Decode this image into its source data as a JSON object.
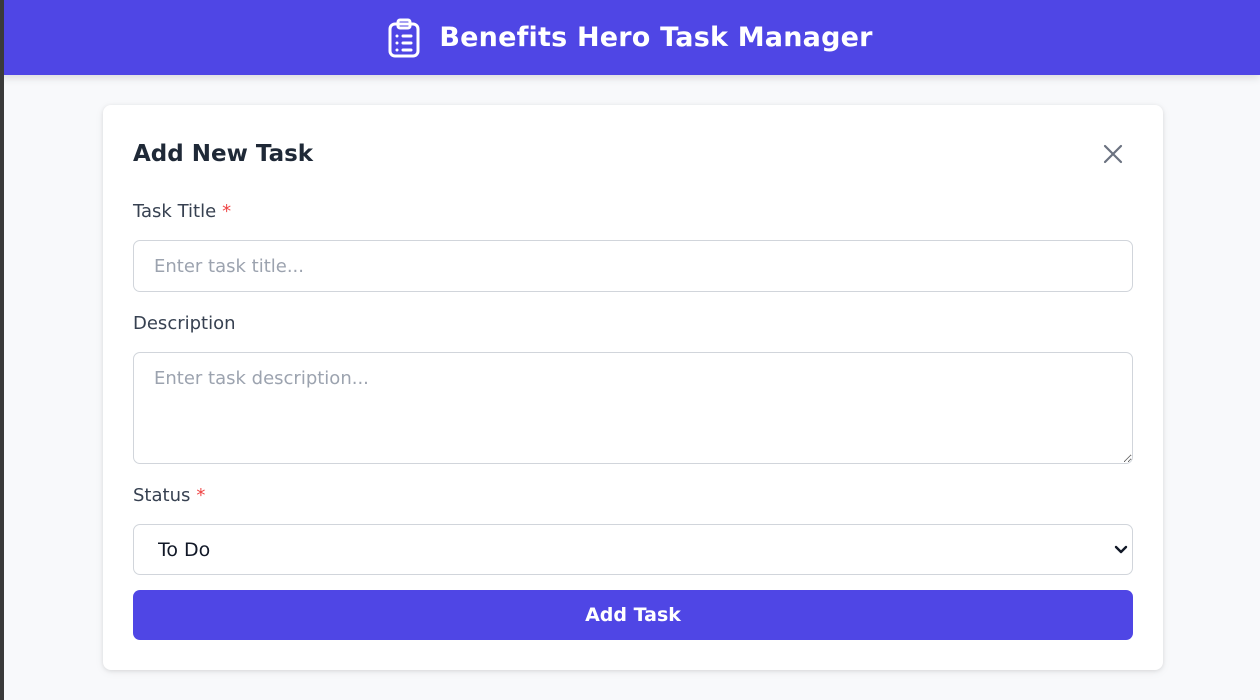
{
  "header": {
    "title": "Benefits Hero Task Manager",
    "icon": "clipboard-list-icon",
    "background_color": "#4f46e5"
  },
  "form": {
    "title": "Add New Task",
    "close_icon": "close-icon",
    "fields": {
      "task_title": {
        "label": "Task Title",
        "required_marker": "*",
        "placeholder": "Enter task title...",
        "value": ""
      },
      "description": {
        "label": "Description",
        "placeholder": "Enter task description...",
        "value": ""
      },
      "status": {
        "label": "Status",
        "required_marker": "*",
        "selected": "To Do",
        "chevron_icon": "chevron-down-icon"
      }
    },
    "submit_label": "Add Task"
  },
  "colors": {
    "accent": "#4f46e5",
    "required": "#ef4444",
    "page_background": "#f8f9fb"
  }
}
